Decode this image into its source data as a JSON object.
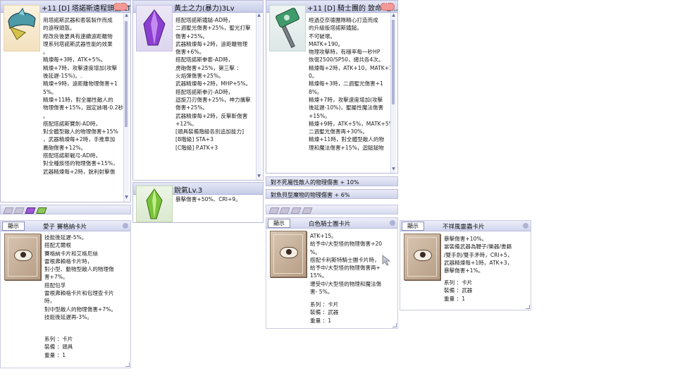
{
  "win1": {
    "title": "+11 [D] 塔諾斯遠程頭盔-LT",
    "lines": [
      "用塔諾斯武器和套裝製作而成",
      "的遠程頭盔。",
      "經改良後更具有連續遠距離物",
      "理系列塔諾斯武器性能的效果",
      "。",
      "精煉每+3時，ATK+5%。",
      "精煉+7時，攻擊速度增加(攻擊",
      "後延遲-15%)。.",
      "精煉+9時，遠距離物理傷害+1",
      "5%。",
      "精煉+11時，對全屬性敵人的",
      "物理傷害+15%，固定詠唱-0.2秒",
      "。",
      "",
      "",
      "搭配塔諾斯寶劍-AD時，",
      "對全體型敵人的物理傷害+15%",
      "，武器精煉每+2時，手推車加",
      "農砲傷害+12%。",
      "搭配塔諾斯戰弓-AD時，",
      "對全種族怪的物理傷害+15%，",
      "武器精煉每+2時，銳利射擊傷"
    ]
  },
  "win2": {
    "title": "黃土之力(暴力)3Lv",
    "lines": [
      "搭配塔諾斯鐵鎚-AD時，",
      "二週聖光傷害+25%，聖光打擊",
      "傷害+25%。",
      "武器精煉每+2時，遠距離物理",
      "傷害+6%。",
      "搭配塔諾斯拳套-AD時，",
      "虎砲傷害+25%，第三擊 ：",
      "火焰彈傷害+25%。",
      "武器精煉每+2時，MHP+5%。",
      "搭配塔諾斯拳刃-AD時，",
      "迴旋刀刃傷害+25%，神力攜擊",
      "傷害+25%。",
      "武器精煉每+2時，反擊斬傷害",
      "+12%。",
      "",
      "[頭具裝備階級各別追加能力]",
      "[B階級] STA+3",
      "[C階級] P.ATK+3"
    ]
  },
  "win3": {
    "title": "+11 [D] 騎士團的 致命 塔...",
    "lines": [
      "經過亞奈德團隊精心打造而成",
      "的升級版塔諾斯鐵鎚。",
      "不可破壞。",
      "MATK+190。",
      "物理攻擊時，有穩率每一秒HP",
      "恢復2500/SP50，總共各4次。",
      "精煉每+2時，ATK+10，MATK+1",
      "0。",
      "精煉每+3時，二週聖光傷害+1",
      "8%。",
      "精煉+7時，攻擊速度增加(攻擊",
      "後延遲-10%)，聖屬性魔法傷害",
      "+15%。",
      "精煉+9時，ATK+5%，MATK+5%，",
      "二週聖光傷害再+30%。",
      "精煉+11時，對全體型敵人的物",
      "理和魔法傷害+15%，迴鎚鎚物"
    ]
  },
  "win4": {
    "title": "銳氣Lv.3",
    "lines": [
      "暴擊傷害+50%、CRI+9。"
    ]
  },
  "strips": {
    "line1": "對不死屬性敵人的物理傷害 + 10%",
    "line2": "對魚貝型魔物的物理傷害 + 6%"
  },
  "card1": {
    "show": "顯示",
    "title": "愛子 賽格納卡片",
    "lines": [
      "技能後延遲-5%。",
      "搭配尤爾根",
      "賽格納卡片和艾格尼絲",
      "雷根弗賴格卡片時，",
      "對小型、動物型敵人的物理傷",
      "害+7%。",
      "搭配包孚",
      "雷根弗賴格卡片和包理查卡片",
      "時，",
      "對中型敵人的物理傷害+7%。",
      "技能後延遲再-3%。"
    ],
    "meta": [
      "系列 ：卡片",
      "裝備 ：頭具",
      "重量 ：1"
    ]
  },
  "card2": {
    "show": "顯示",
    "title": "白色騎士團卡片",
    "lines": [
      "ATK+15。",
      "給予中/大型怪的物理傷害+20",
      "%。",
      "搭配卡利斯特騎士團卡片時，",
      "給予中/大型怪的物理傷害再+",
      "15%。",
      "遭受中/大型怪的物理和魔法傷",
      "害- 5%。"
    ],
    "meta": [
      "系列 ：卡片",
      "裝備 ：武器",
      "重量 ：1"
    ]
  },
  "card3": {
    "show": "顯示",
    "title": "不祥風靈蟲卡片",
    "lines": [
      "暴擊傷害+10%。",
      "當裝備武器為鞭子/樂器/書籍",
      "/雙手劍/雙手矛時，CRI+5，",
      "武器精煉每+1時，ATK+3，",
      "暴擊傷害+1%。"
    ],
    "meta": [
      "系列 ：卡片",
      "裝備 ：武器",
      "重量 ：1"
    ]
  },
  "colors": {
    "titlebar": "#c7cce8",
    "close": "#f29a98",
    "scroll_thumb": "#aeb3d6"
  }
}
